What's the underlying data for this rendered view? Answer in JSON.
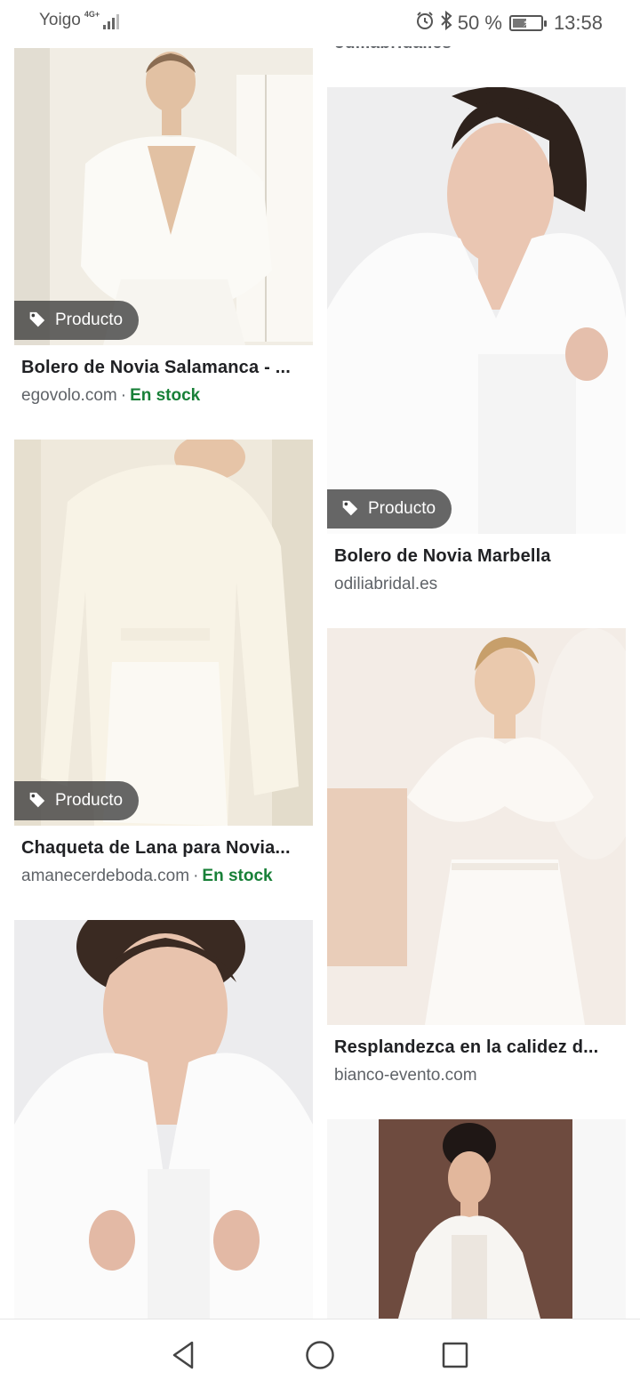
{
  "status_bar": {
    "carrier": "Yoigo",
    "network": "4G+",
    "battery_text": "50 %",
    "battery_level": 0.5,
    "time": "13:58",
    "icons": [
      "alarm-icon",
      "bluetooth-icon",
      "battery-icon"
    ]
  },
  "results": {
    "partial_top_domain": "odiliabridal.es",
    "chip_label": "Producto",
    "items": [
      {
        "title": "Bolero de Novia Salamanca - ...",
        "domain": "egovolo.com",
        "separator": "·",
        "stock": "En stock",
        "has_chip": true
      },
      {
        "title": "Chaqueta de Lana para Novia...",
        "domain": "amanecerdeboda.com",
        "separator": "·",
        "stock": "En stock",
        "has_chip": true
      },
      {
        "title": "Bolero de Novia Marbella",
        "domain": "odiliabridal.es",
        "has_chip": true
      },
      {
        "title": "Resplandezca en la calidez d...",
        "domain": "bianco-evento.com",
        "has_chip": false
      }
    ]
  },
  "nav_bar": {
    "buttons": [
      "back-icon",
      "home-icon",
      "recents-icon"
    ]
  },
  "colors": {
    "stock_green": "#188038",
    "chip_bg": "#3c3c3c",
    "meta_gray": "#5f6368"
  }
}
